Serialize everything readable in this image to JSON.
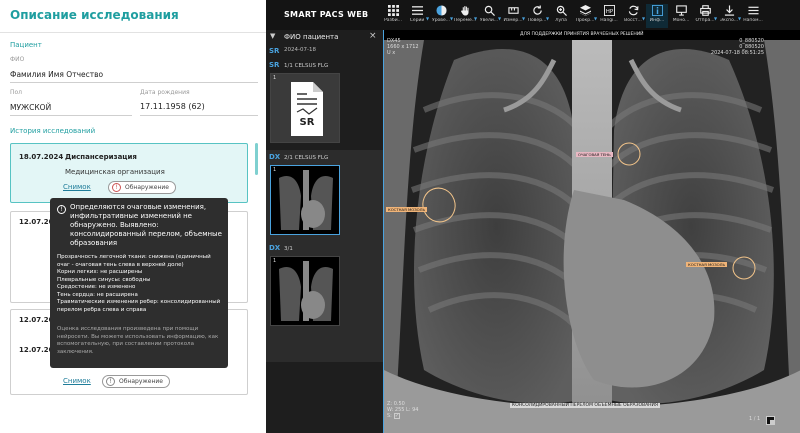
{
  "left_panel": {
    "title": "Описание исследования",
    "patient_section": "Пациент",
    "fio_label": "ФИО",
    "fio_value": "Фамилия Имя Отчество",
    "sex_label": "Пол",
    "sex_value": "МУЖСКОЙ",
    "birth_label": "Дата рождения",
    "birth_value": "17.11.1958 (62)",
    "history_section": "История исследований",
    "studies": [
      {
        "date": "18.07.2024",
        "type": "Диспансеризация",
        "org": "Медицинская организация",
        "snapshot": "Снимок",
        "badge": "Обнаружение"
      },
      {
        "date": "12.07.2024"
      },
      {
        "date": "12.07.2024"
      },
      {
        "date": "12.07.2024",
        "snapshot": "Снимок",
        "badge": "Обнаружение"
      }
    ],
    "tooltip": {
      "headline": "Определяются очаговые изменения, инфильтративные изменений не обнаружено. Выявлено: консолидированный перелом, объемные образования",
      "details": "Прозрачность легочной ткани: снижена (единичный очаг - очаговая тень слева в верхней доле)\nКорни легких: не расширены\nПлевральные синусы: свободны\nСредостение: не изменено\nТень сердца: не расширена\nТравматические изменения ребер: консолидированный перелом ребра слева и справа",
      "note": "Оценка исследования произведена при помощи нейросети. Вы можете использовать информацию, как вспомогательную, при составлении протокола заключения."
    }
  },
  "toolbar": {
    "brand": "SMART PACS WEB",
    "tools": [
      {
        "label": "Разби...",
        "icon": "grid-icon"
      },
      {
        "label": "Серии",
        "icon": "list-icon"
      },
      {
        "label": "Урове...",
        "icon": "contrast-icon"
      },
      {
        "label": "Переме...",
        "icon": "hand-icon"
      },
      {
        "label": "Увели...",
        "icon": "zoom-icon"
      },
      {
        "label": "Измер...",
        "icon": "ruler-icon"
      },
      {
        "label": "Повер...",
        "icon": "rotate-icon"
      },
      {
        "label": "Лупа",
        "icon": "magnifier-icon"
      },
      {
        "label": "Прокр...",
        "icon": "layers-icon"
      },
      {
        "label": "Hangi...",
        "icon": "hp-icon"
      },
      {
        "label": "Восст...",
        "icon": "refresh-icon"
      },
      {
        "label": "Инф...",
        "icon": "info-icon"
      },
      {
        "label": "Моно...",
        "icon": "monitor-icon"
      },
      {
        "label": "Отпра...",
        "icon": "print-icon"
      },
      {
        "label": "Экспо...",
        "icon": "download-icon"
      },
      {
        "label": "Напом...",
        "icon": "menu-icon"
      }
    ]
  },
  "series_panel": {
    "patient": "ФИО пациента",
    "date": "2024-07-18",
    "series": [
      {
        "modality": "SR",
        "desc": "1/1 CELSUS FLG",
        "num": "1",
        "sr_text": "SR"
      },
      {
        "modality": "DX",
        "desc": "2/1 CELSUS FLG",
        "num": "1"
      },
      {
        "modality": "DX",
        "desc": "3/1",
        "num": "1"
      }
    ]
  },
  "viewer": {
    "caption": "ДЛЯ ПОДДЕРЖКИ ПРИНЯТИЯ ВРАЧЕБНЫХ РЕШЕНИЙ",
    "top_left": [
      "DX45",
      "1660 x 1712",
      "U x"
    ],
    "top_right": [
      "0_880520",
      "0_880520",
      "2024-07-18 08:51:25"
    ],
    "bottom_left": [
      "Z: 0.50",
      "W: 255 L: 94",
      "S:"
    ],
    "pager": "1 / 1",
    "annotations": {
      "top": "ОЧАГОВАЯ ТЕНЬ",
      "left": "КОСТНАЯ МОЗОЛЬ",
      "right": "КОСТНАЯ МОЗОЛЬ",
      "bottom": "КОНСОЛИДИРОВАННЫЙ ПЕРЕЛОМ   ОБЪЕМНЫЕ ОБРАЗОВАНИЯ"
    },
    "colors": {
      "accent": "#4aa3df",
      "nodule_box": "#e8b7c2",
      "callus_box": "#f0b478",
      "ellipse": "#f2c48a"
    }
  }
}
